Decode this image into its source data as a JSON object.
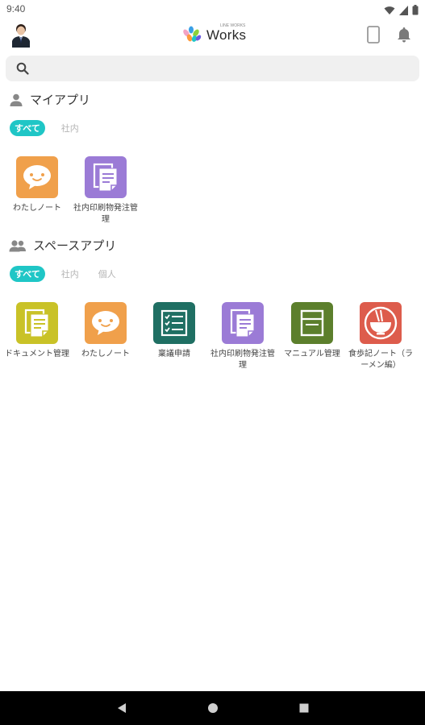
{
  "status_bar": {
    "time": "9:40"
  },
  "header": {
    "logo_sub": "LINE WORKS",
    "logo_text": "Works"
  },
  "search": {
    "placeholder": ""
  },
  "my_apps": {
    "title": "マイアプリ",
    "filters": [
      {
        "label": "すべて",
        "active": true
      },
      {
        "label": "社内",
        "active": false
      }
    ],
    "apps": [
      {
        "label": "わたしノート",
        "icon": "speech-bubble-icon",
        "color": "#f0a04b"
      },
      {
        "label": "社内印刷物発注管理",
        "icon": "document-icon",
        "color": "#9b7bd6"
      }
    ]
  },
  "space_apps": {
    "title": "スペースアプリ",
    "filters": [
      {
        "label": "すべて",
        "active": true
      },
      {
        "label": "社内",
        "active": false
      },
      {
        "label": "個人",
        "active": false
      }
    ],
    "apps": [
      {
        "label": "ドキュメント管理",
        "icon": "document-icon",
        "color": "#c9c227"
      },
      {
        "label": "わたしノート",
        "icon": "speech-bubble-icon",
        "color": "#f0a04b"
      },
      {
        "label": "稟議申請",
        "icon": "checklist-icon",
        "color": "#1f6f63"
      },
      {
        "label": "社内印刷物発注管理",
        "icon": "document-icon",
        "color": "#9b7bd6"
      },
      {
        "label": "マニュアル管理",
        "icon": "book-icon",
        "color": "#5c7f2c"
      },
      {
        "label": "食歩記ノート（ラーメン編）",
        "icon": "ramen-bowl-icon",
        "color": "#dd5c4c"
      }
    ]
  }
}
